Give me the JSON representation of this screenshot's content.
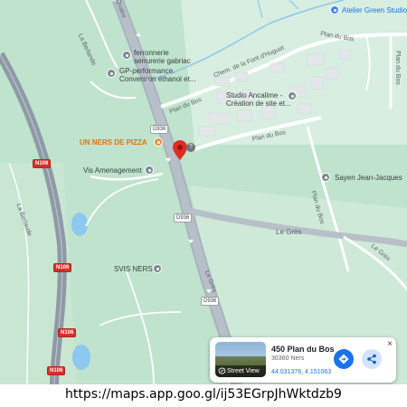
{
  "map": {
    "roads": {
      "la_berlande_top": "La Berlande",
      "la_berlaude_west": "La Berlaude",
      "chem_fontdhuguet": "Chem. de la Font d'Huguet",
      "plan_du_bos_1": "Plan du Bos",
      "plan_du_bos_2": "Plan du Bos",
      "plan_du_bos_3": "Plan du Bos",
      "plan_du_bos_4": "Plan du Bos",
      "plan_du_bos_5": "Plan du Bos",
      "le_gres_1": "Le Grès",
      "le_gres_2": "Le Grès",
      "le_gres_3": "Le Grès",
      "quatre": "Quatre"
    },
    "shields": {
      "d936_a": "D936",
      "d936_b": "D936",
      "d936_c": "D936",
      "n106_a": "N106",
      "n106_b": "N106",
      "n106_c": "N106",
      "n106_d": "N106"
    },
    "pois": {
      "ferronnerie": "ferronnerie\nserrurerie gabriac",
      "gp_performance": "GP-performance.\nConversion éthanol et...",
      "un_ners_de_pizza": "UN NERS DE PIZZA",
      "vis_amenagement": "Vis Amenagement",
      "studio_ancalime": "Studio Ancalime -\nCréation de site et...",
      "sayen": "Sayen Jean-Jacques",
      "svis_ners": "SVIS NERS",
      "atelier_green": "Atelier Green Studio"
    },
    "pin": {
      "color": "#d93025",
      "help_glyph": "?"
    }
  },
  "place_card": {
    "title": "450 Plan du Bos",
    "subtitle": "30360 Ners",
    "coords": "44.031376, 4.151063",
    "street_view_label": "Street View",
    "close_glyph": "×",
    "directions_icon": "directions-icon",
    "share_icon": "share-icon"
  },
  "caption": {
    "url": "https://maps.app.goo.gl/ij53EGrpJhWktdzb9"
  },
  "colors": {
    "land": "#bfe3cd",
    "road_major": "#a9b3be",
    "highway": "#8f9aa6",
    "water": "#8cc8ef",
    "accent": "#1a73e8"
  }
}
